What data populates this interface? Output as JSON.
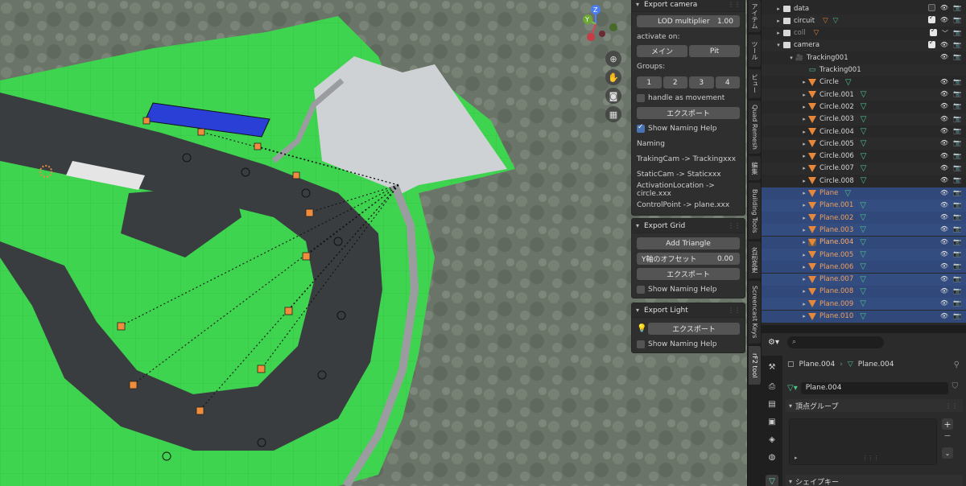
{
  "npanel": {
    "export_camera": {
      "title": "Export camera",
      "lod_label": "LOD multiplier",
      "lod_value": "1.00",
      "activate_on": "activate on:",
      "main_btn": "メイン",
      "pit_btn": "Pit",
      "groups_label": "Groups:",
      "groups": [
        "1",
        "2",
        "3",
        "4"
      ],
      "handle_movement": "handle as movement",
      "export_btn": "エクスポート",
      "show_naming_help": "Show Naming Help",
      "naming": "Naming",
      "naming_lines": [
        "TrakingCam -> Trackingxxx",
        "StaticCam -> Staticxxx",
        "ActivationLocation -> circle.xxx",
        "ControlPoint -> plane.xxx"
      ]
    },
    "export_grid": {
      "title": "Export Grid",
      "add_triangle": "Add Triangle",
      "y_offset_label": "Y軸のオフセット",
      "y_offset_value": "0.00",
      "export_btn": "エクスポート",
      "show_naming_help": "Show Naming Help"
    },
    "export_light": {
      "title": "Export Light",
      "export_btn": "エクスポート",
      "show_naming_help": "Show Naming Help"
    }
  },
  "vtabs": [
    "アイテム",
    "ツール",
    "ビュー",
    "Quad Remesh",
    "編集",
    "Building Tools",
    "名前変更",
    "Screencast Keys",
    "rF2 tool"
  ],
  "outliner": {
    "rows": [
      {
        "name": "data",
        "type": "collection",
        "depth": 1,
        "arrow": "▸",
        "check": "off"
      },
      {
        "name": "circuit",
        "type": "collection",
        "depth": 1,
        "arrow": "▸",
        "check": "on",
        "extra": "⁴⁸ ⁴"
      },
      {
        "name": "coll",
        "type": "collection",
        "depth": 1,
        "arrow": "▸",
        "check": "on",
        "dim": true
      },
      {
        "name": "camera",
        "type": "collection",
        "depth": 1,
        "arrow": "▾",
        "check": "on"
      },
      {
        "name": "Tracking001",
        "type": "camera",
        "depth": 2,
        "arrow": "▾"
      },
      {
        "name": "Tracking001",
        "type": "camdata",
        "depth": 3,
        "arrow": ""
      },
      {
        "name": "Circle",
        "type": "mesh",
        "depth": 3,
        "arrow": "▸"
      },
      {
        "name": "Circle.001",
        "type": "mesh",
        "depth": 3,
        "arrow": "▸"
      },
      {
        "name": "Circle.002",
        "type": "mesh",
        "depth": 3,
        "arrow": "▸"
      },
      {
        "name": "Circle.003",
        "type": "mesh",
        "depth": 3,
        "arrow": "▸"
      },
      {
        "name": "Circle.004",
        "type": "mesh",
        "depth": 3,
        "arrow": "▸"
      },
      {
        "name": "Circle.005",
        "type": "mesh",
        "depth": 3,
        "arrow": "▸"
      },
      {
        "name": "Circle.006",
        "type": "mesh",
        "depth": 3,
        "arrow": "▸"
      },
      {
        "name": "Circle.007",
        "type": "mesh",
        "depth": 3,
        "arrow": "▸"
      },
      {
        "name": "Circle.008",
        "type": "mesh",
        "depth": 3,
        "arrow": "▸"
      },
      {
        "name": "Plane",
        "type": "mesh",
        "depth": 3,
        "arrow": "▸",
        "sel": true
      },
      {
        "name": "Plane.001",
        "type": "mesh",
        "depth": 3,
        "arrow": "▸",
        "sel": true
      },
      {
        "name": "Plane.002",
        "type": "mesh",
        "depth": 3,
        "arrow": "▸",
        "sel": true
      },
      {
        "name": "Plane.003",
        "type": "mesh",
        "depth": 3,
        "arrow": "▸",
        "sel": true
      },
      {
        "name": "Plane.004",
        "type": "mesh",
        "depth": 3,
        "arrow": "▸",
        "sel": true,
        "active": true
      },
      {
        "name": "Plane.005",
        "type": "mesh",
        "depth": 3,
        "arrow": "▸",
        "sel": true
      },
      {
        "name": "Plane.006",
        "type": "mesh",
        "depth": 3,
        "arrow": "▸",
        "sel": true
      },
      {
        "name": "Plane.007",
        "type": "mesh",
        "depth": 3,
        "arrow": "▸",
        "sel": true
      },
      {
        "name": "Plane.008",
        "type": "mesh",
        "depth": 3,
        "arrow": "▸",
        "sel": true
      },
      {
        "name": "Plane.009",
        "type": "mesh",
        "depth": 3,
        "arrow": "▸",
        "sel": true
      },
      {
        "name": "Plane.010",
        "type": "mesh",
        "depth": 3,
        "arrow": "▸",
        "sel": true
      }
    ]
  },
  "properties": {
    "breadcrumb_object": "Plane.004",
    "breadcrumb_mesh": "Plane.004",
    "mesh_name": "Plane.004",
    "vertex_groups": "頂点グループ",
    "shape_keys": "シェイプキー"
  },
  "colors": {
    "accent": "#4772b3",
    "selection": "#334d80",
    "grass": "#3fd44f",
    "asphalt": "#3a3d40",
    "object_orange": "#e6873a",
    "mesh_green": "#4fc38b"
  }
}
